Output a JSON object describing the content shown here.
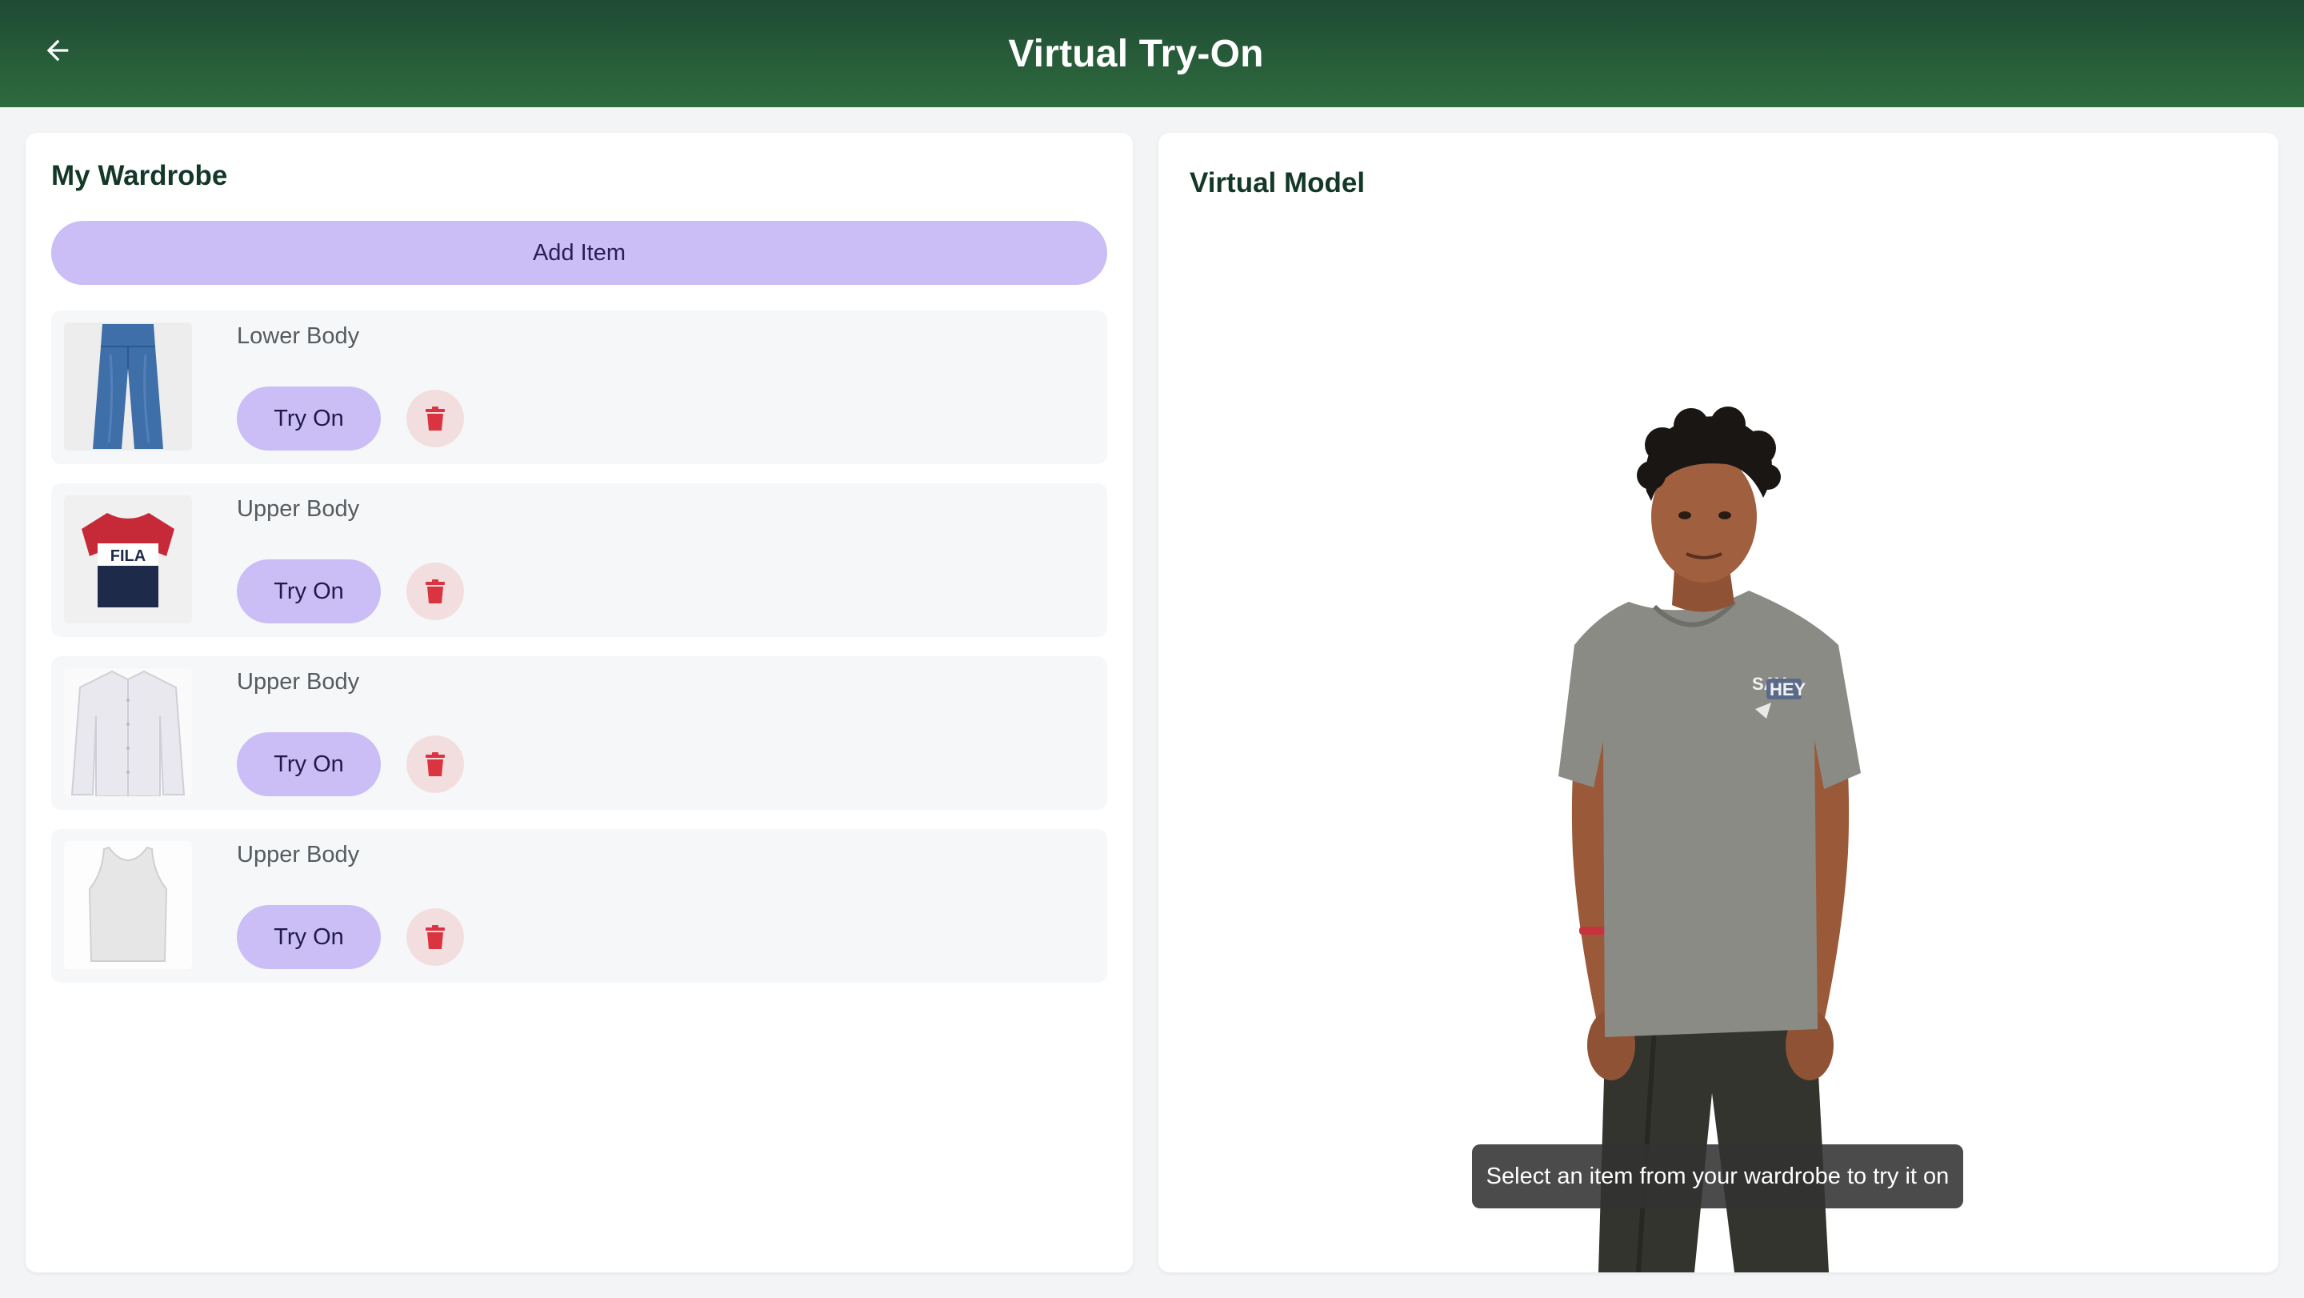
{
  "header": {
    "title": "Virtual Try-On",
    "back_icon": "arrow-left-icon"
  },
  "wardrobe": {
    "title": "My Wardrobe",
    "add_button_label": "Add Item",
    "items": [
      {
        "category": "Lower Body",
        "image": "jeans",
        "try_on_label": "Try On",
        "delete_icon": "trash-icon"
      },
      {
        "category": "Upper Body",
        "image": "fila-tshirt",
        "try_on_label": "Try On",
        "delete_icon": "trash-icon"
      },
      {
        "category": "Upper Body",
        "image": "white-dress-shirt",
        "try_on_label": "Try On",
        "delete_icon": "trash-icon"
      },
      {
        "category": "Upper Body",
        "image": "white-tank-top",
        "try_on_label": "Try On",
        "delete_icon": "trash-icon"
      }
    ]
  },
  "model": {
    "title": "Virtual Model",
    "hint": "Select an item from your wardrobe to try it on",
    "shirt_print": [
      "SAY",
      "HEY"
    ]
  },
  "colors": {
    "header": "#1f4a34",
    "accent": "#cbbdf6",
    "danger": "#d9343f"
  }
}
